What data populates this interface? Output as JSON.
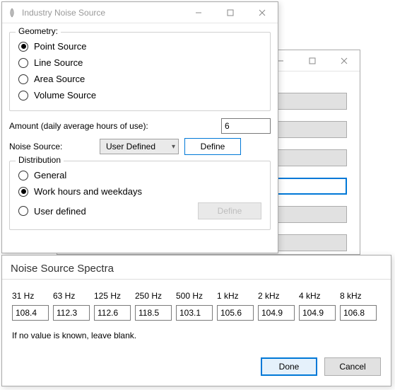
{
  "main": {
    "title": "Industry Noise Source",
    "geometry": {
      "legend": "Geometry:",
      "options": {
        "point": "Point Source",
        "line": "Line Source",
        "area": "Area Source",
        "volume": "Volume Source"
      },
      "selected": "point"
    },
    "amount": {
      "label": "Amount (daily average hours of use):",
      "value": "6"
    },
    "noise_source": {
      "label": "Noise Source:",
      "combo_value": "User Defined",
      "define_label": "Define"
    },
    "distribution": {
      "legend": "Distribution",
      "options": {
        "general": "General",
        "work": "Work hours and weekdays",
        "user": "User defined"
      },
      "selected": "work",
      "define_label": "Define"
    }
  },
  "spectra": {
    "title": "Noise Source Spectra",
    "freqs": [
      "31 Hz",
      "63 Hz",
      "125 Hz",
      "250 Hz",
      "500 Hz",
      "1 kHz",
      "2 kHz",
      "4 kHz",
      "8 kHz"
    ],
    "values": [
      "108.4",
      "112.3",
      "112.6",
      "118.5",
      "103.1",
      "105.6",
      "104.9",
      "104.9",
      "106.8"
    ],
    "note": "If no value is known, leave blank.",
    "done": "Done",
    "cancel": "Cancel"
  }
}
